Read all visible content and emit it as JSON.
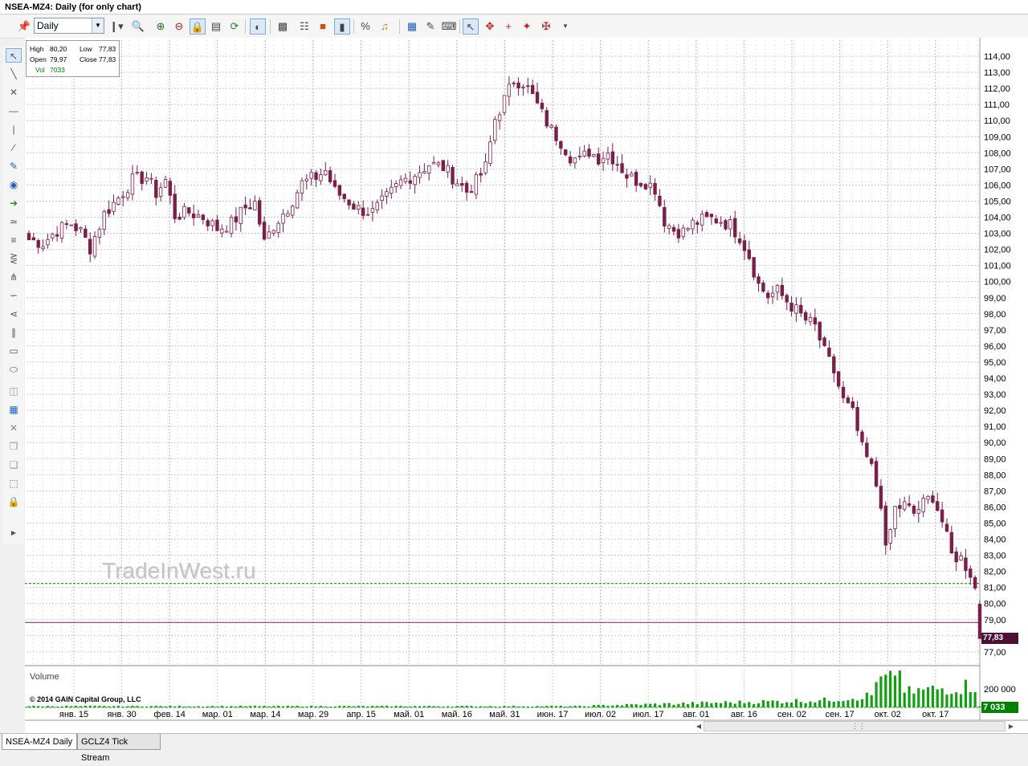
{
  "window": {
    "title": "NSEA-MZ4: Daily (for only chart)"
  },
  "toolbar": {
    "period_value": "Daily",
    "icons": [
      "pin-icon",
      "bar-type-icon",
      "zoom-icon",
      "zoom-in-icon",
      "zoom-out-icon",
      "lock-icon",
      "page-icon",
      "refresh-icon",
      "compare-icon",
      "indicator-icon",
      "tree-icon",
      "color-icon",
      "chart-bars-icon",
      "percent-icon",
      "bell-icon",
      "book-icon",
      "pen-icon",
      "eraser-icon",
      "cursor-icon",
      "crosshair-icon",
      "cross-icon",
      "star-cross-icon",
      "dot-cross-icon",
      "overflow-icon"
    ]
  },
  "lefttools": {
    "icons": [
      "cursor-icon",
      "trend-line-icon",
      "channel-icon",
      "hline-icon",
      "vline-icon",
      "ray-icon",
      "note-icon",
      "callout-icon",
      "arrow-icon",
      "arc-icon",
      "fib-icon",
      "gann-icon",
      "pitchfork-icon",
      "regression-icon",
      "fan-icon",
      "parallel-icon",
      "rectangle-icon",
      "ellipse-icon",
      "layer-icon",
      "properties-icon",
      "delete-icon",
      "copy-icon",
      "paste-icon",
      "select-icon",
      "lock-icon",
      "expand-icon"
    ]
  },
  "ohlc": {
    "high_label": "High",
    "high": "80,20",
    "low_label": "Low",
    "low": "77,83",
    "open_label": "Open",
    "open": "79,97",
    "close_label": "Close",
    "close": "77,83",
    "vol_label": "Vol",
    "vol": "7033"
  },
  "watermark": "TradeInWest.ru",
  "volume_panel": {
    "label": "Volume",
    "copyright": "© 2014 GAIN Capital Group, LLC",
    "axis_label": "200 000",
    "current_tag": "7 033"
  },
  "price_tag": "77,83",
  "tabs": [
    {
      "label": "NSEA-MZ4 Daily",
      "selected": true
    },
    {
      "label": "GCLZ4 Tick Stream",
      "selected": false
    }
  ],
  "colors": {
    "candle": "#7a1f4b",
    "volume": "#12a012",
    "grid": "#c9c9c9",
    "last_price_line": "#7a1f6b",
    "high_line": "#008000"
  },
  "chart_data": {
    "type": "candlestick",
    "title": "NSEA-MZ4: Daily (for only chart)",
    "xlabel": "",
    "ylabel": "",
    "ylim": [
      77,
      114
    ],
    "y_ticks": [
      "114,00",
      "113,00",
      "112,00",
      "111,00",
      "110,00",
      "109,00",
      "108,00",
      "107,00",
      "106,00",
      "105,00",
      "104,00",
      "103,00",
      "102,00",
      "101,00",
      "100,00",
      "99,00",
      "98,00",
      "97,00",
      "96,00",
      "95,00",
      "94,00",
      "93,00",
      "92,00",
      "91,00",
      "90,00",
      "89,00",
      "88,00",
      "87,00",
      "86,00",
      "85,00",
      "84,00",
      "83,00",
      "82,00",
      "81,00",
      "80,00",
      "79,00",
      "78,00",
      "77,00"
    ],
    "x_ticks": [
      "янв. 15",
      "янв. 30",
      "фев. 14",
      "мар. 01",
      "мар. 14",
      "мар. 29",
      "апр. 15",
      "май. 01",
      "май. 16",
      "май. 31",
      "июн. 17",
      "июл. 02",
      "июл. 17",
      "авг. 01",
      "авг. 16",
      "сен. 02",
      "сен. 17",
      "окт. 02",
      "окт. 17"
    ],
    "close_anchors": [
      [
        0,
        102.6
      ],
      [
        3,
        102.4
      ],
      [
        6,
        103.2
      ],
      [
        9,
        103.6
      ],
      [
        11,
        103.1
      ],
      [
        13,
        102.1
      ],
      [
        16,
        104.2
      ],
      [
        19,
        105.2
      ],
      [
        22,
        106.3
      ],
      [
        25,
        106.5
      ],
      [
        27,
        105.5
      ],
      [
        29,
        106.3
      ],
      [
        31,
        104.1
      ],
      [
        34,
        104.3
      ],
      [
        37,
        104.0
      ],
      [
        40,
        103.3
      ],
      [
        43,
        103.6
      ],
      [
        46,
        104.6
      ],
      [
        48,
        104.9
      ],
      [
        50,
        102.4
      ],
      [
        52,
        103.5
      ],
      [
        55,
        104.6
      ],
      [
        58,
        106.1
      ],
      [
        61,
        106.5
      ],
      [
        63,
        106.9
      ],
      [
        65,
        105.6
      ],
      [
        67,
        105.2
      ],
      [
        70,
        104.5
      ],
      [
        73,
        104.3
      ],
      [
        76,
        105.2
      ],
      [
        79,
        106.2
      ],
      [
        82,
        106.7
      ],
      [
        85,
        107.3
      ],
      [
        88,
        107.1
      ],
      [
        91,
        106.2
      ],
      [
        93,
        105.6
      ],
      [
        95,
        106.2
      ],
      [
        97,
        107.1
      ],
      [
        99,
        110.1
      ],
      [
        101,
        111.3
      ],
      [
        103,
        112.5
      ],
      [
        105,
        112.4
      ],
      [
        107,
        111.5
      ],
      [
        109,
        110.4
      ],
      [
        111,
        109.4
      ],
      [
        113,
        108.7
      ],
      [
        115,
        107.8
      ],
      [
        117,
        107.5
      ],
      [
        119,
        108.1
      ],
      [
        121,
        107.7
      ],
      [
        123,
        108.0
      ],
      [
        125,
        107.4
      ],
      [
        127,
        106.6
      ],
      [
        129,
        106.3
      ],
      [
        131,
        106.2
      ],
      [
        133,
        105.8
      ],
      [
        135,
        103.8
      ],
      [
        137,
        103.2
      ],
      [
        139,
        103.1
      ],
      [
        141,
        103.6
      ],
      [
        143,
        103.8
      ],
      [
        145,
        103.9
      ],
      [
        147,
        103.8
      ],
      [
        149,
        103.5
      ],
      [
        151,
        102.8
      ],
      [
        153,
        101.6
      ],
      [
        155,
        99.8
      ],
      [
        157,
        99.1
      ],
      [
        159,
        99.4
      ],
      [
        161,
        98.8
      ],
      [
        163,
        98.2
      ],
      [
        165,
        97.6
      ],
      [
        167,
        97.2
      ],
      [
        169,
        95.6
      ],
      [
        171,
        94.4
      ],
      [
        173,
        92.6
      ],
      [
        175,
        91.8
      ],
      [
        177,
        89.6
      ],
      [
        179,
        88.4
      ],
      [
        181,
        86.3
      ],
      [
        182,
        83.2
      ],
      [
        184,
        85.9
      ],
      [
        186,
        86.1
      ],
      [
        188,
        85.6
      ],
      [
        190,
        86.2
      ],
      [
        192,
        86.7
      ],
      [
        194,
        85.1
      ],
      [
        196,
        83.0
      ],
      [
        198,
        82.8
      ],
      [
        200,
        81.9
      ],
      [
        202,
        79.97
      ]
    ],
    "last_candle": {
      "open": 79.97,
      "high": 80.2,
      "low": 77.83,
      "close": 77.83,
      "volume": 7033
    },
    "volume_range": [
      0,
      260000
    ],
    "volume_peak": 240000
  }
}
